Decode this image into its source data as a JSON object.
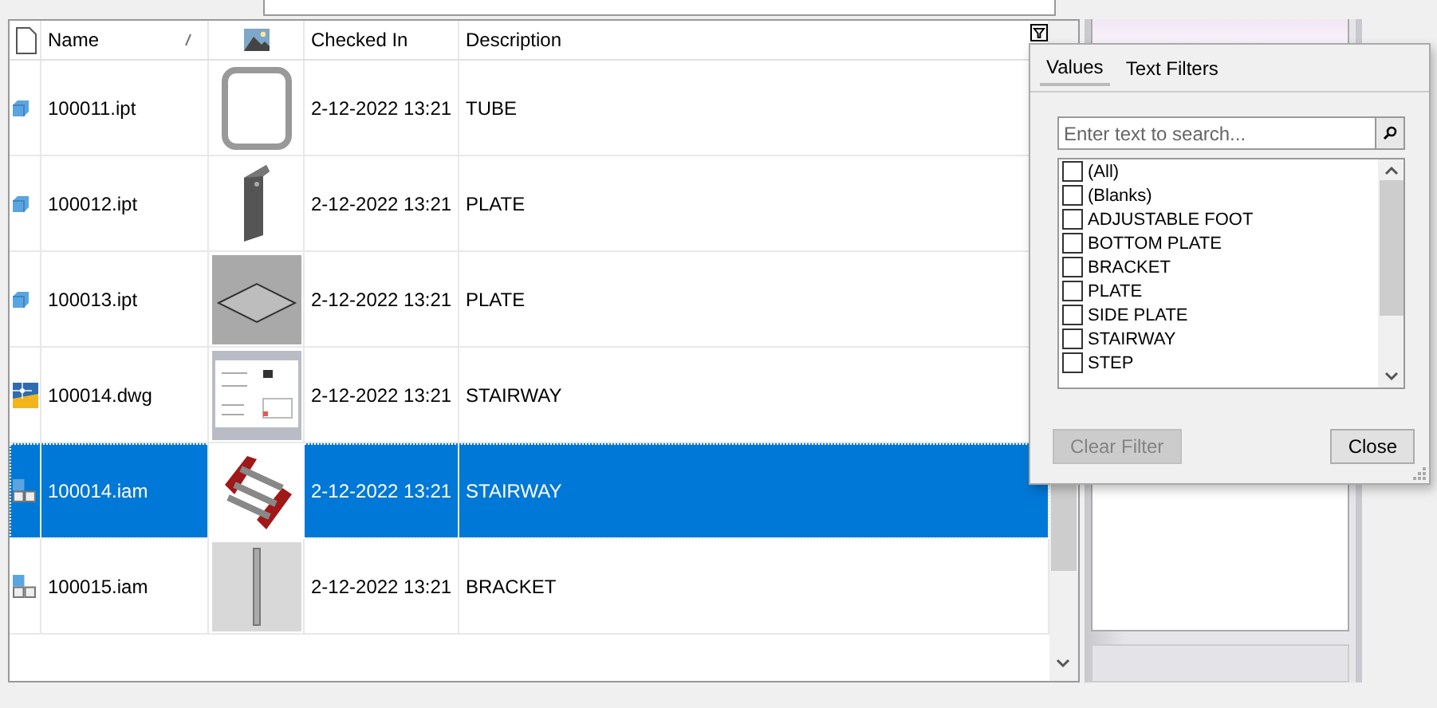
{
  "columns": [
    {
      "label": "Name",
      "sorted": true
    },
    {
      "label": "Checked In",
      "sorted": false
    },
    {
      "label": "Description",
      "sorted": false
    }
  ],
  "rows": [
    {
      "kind": "part",
      "name": "100011.ipt",
      "checked_in": "2-12-2022 13:21",
      "description": "TUBE",
      "selected": false
    },
    {
      "kind": "part",
      "name": "100012.ipt",
      "checked_in": "2-12-2022 13:21",
      "description": "PLATE",
      "selected": false
    },
    {
      "kind": "part",
      "name": "100013.ipt",
      "checked_in": "2-12-2022 13:21",
      "description": "PLATE",
      "selected": false
    },
    {
      "kind": "drawing",
      "name": "100014.dwg",
      "checked_in": "2-12-2022 13:21",
      "description": "STAIRWAY",
      "selected": false
    },
    {
      "kind": "assembly",
      "name": "100014.iam",
      "checked_in": "2-12-2022 13:21",
      "description": "STAIRWAY",
      "selected": true
    },
    {
      "kind": "assembly",
      "name": "100015.iam",
      "checked_in": "2-12-2022 13:21",
      "description": "BRACKET",
      "selected": false
    }
  ],
  "filter": {
    "tabs": [
      {
        "label": "Values",
        "selected": true
      },
      {
        "label": "Text Filters",
        "selected": false
      }
    ],
    "search": {
      "placeholder": "Enter text to search..."
    },
    "items": [
      {
        "label": "(All)",
        "checked": false
      },
      {
        "label": "(Blanks)",
        "checked": false
      },
      {
        "label": "ADJUSTABLE FOOT",
        "checked": false
      },
      {
        "label": "BOTTOM PLATE",
        "checked": false
      },
      {
        "label": "BRACKET",
        "checked": false
      },
      {
        "label": "PLATE",
        "checked": false
      },
      {
        "label": "SIDE PLATE",
        "checked": false
      },
      {
        "label": "STAIRWAY",
        "checked": false
      },
      {
        "label": "STEP",
        "checked": false
      }
    ],
    "buttons": [
      {
        "label": "Clear Filter",
        "disabled": true
      },
      {
        "label": "Close",
        "disabled": false
      }
    ]
  }
}
